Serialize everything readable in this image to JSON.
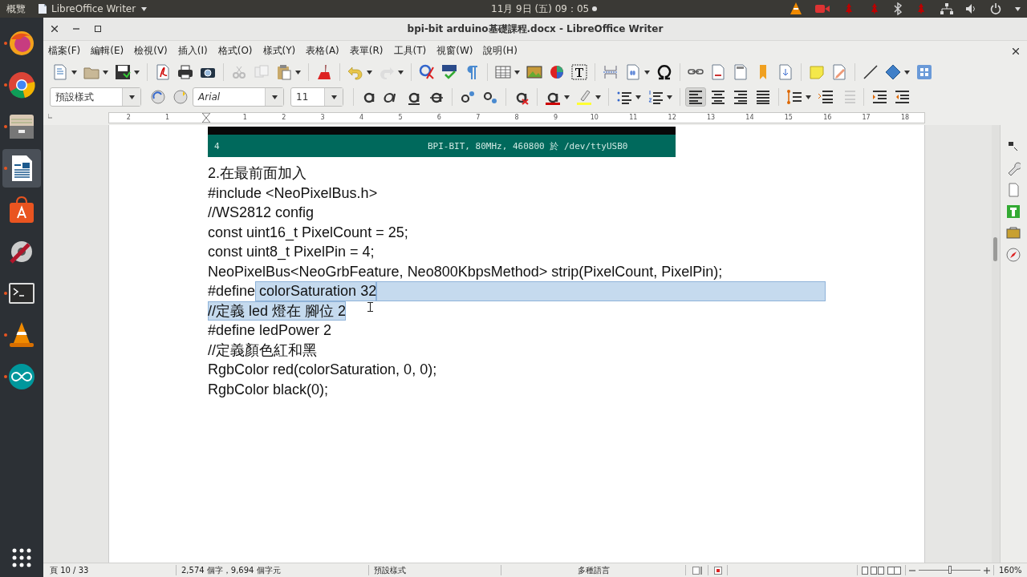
{
  "topbar": {
    "activities": "概覽",
    "app_menu": "LibreOffice Writer",
    "clock": "11月 9日 (五) 09：05"
  },
  "dock": [
    {
      "kind": "firefox",
      "running": true,
      "selected": false
    },
    {
      "kind": "chrome",
      "running": true,
      "selected": false
    },
    {
      "kind": "files",
      "running": true,
      "selected": false
    },
    {
      "kind": "writer",
      "running": true,
      "selected": true
    },
    {
      "kind": "store",
      "running": false,
      "selected": false
    },
    {
      "kind": "settings",
      "running": false,
      "selected": false
    },
    {
      "kind": "terminal",
      "running": true,
      "selected": false
    },
    {
      "kind": "vlc",
      "running": true,
      "selected": false
    },
    {
      "kind": "arduino",
      "running": true,
      "selected": false
    }
  ],
  "window": {
    "title": "bpi-bit arduino基礎課程.docx - LibreOffice Writer"
  },
  "menu": [
    "檔案(F)",
    "編輯(E)",
    "檢視(V)",
    "插入(I)",
    "格式(O)",
    "樣式(Y)",
    "表格(A)",
    "表單(R)",
    "工具(T)",
    "視窗(W)",
    "說明(H)"
  ],
  "formatting": {
    "paragraph_style": "預設樣式",
    "font": "Arial",
    "size": "11",
    "alignment": [
      {
        "selected": true
      },
      {
        "selected": false
      },
      {
        "selected": false
      },
      {
        "selected": false
      }
    ]
  },
  "ruler": {
    "left_labels": [
      "2",
      "1"
    ],
    "right_labels": [
      "1",
      "2",
      "3",
      "4",
      "5",
      "6",
      "7",
      "8",
      "9",
      "10",
      "11",
      "12",
      "13",
      "14",
      "15",
      "16",
      "17",
      "18"
    ]
  },
  "document": {
    "terminal_strip": {
      "line_number": "4",
      "status": "BPI-BIT, 80MHz, 460800 於 /dev/ttyUSB0"
    },
    "paragraphs": [
      {
        "runs": [
          {
            "text": "2.在最前面加入",
            "selected": false
          }
        ],
        "break_selected": false
      },
      {
        "runs": [
          {
            "text": "#include <NeoPixelBus.h>",
            "selected": false
          }
        ],
        "break_selected": false
      },
      {
        "runs": [
          {
            "text": "//WS2812 config",
            "selected": false
          }
        ],
        "break_selected": false
      },
      {
        "runs": [
          {
            "text": "const uint16_t PixelCount = 25;",
            "selected": false
          }
        ],
        "break_selected": false
      },
      {
        "runs": [
          {
            "text": "const uint8_t PixelPin = 4;",
            "selected": false
          }
        ],
        "break_selected": false
      },
      {
        "runs": [
          {
            "text": "NeoPixelBus<NeoGrbFeature, Neo800KbpsMethod> strip(PixelCount, PixelPin);",
            "selected": false
          }
        ],
        "break_selected": false
      },
      {
        "runs": [
          {
            "text": "#define",
            "selected": false
          },
          {
            "text": " colorSaturation 32",
            "selected": true
          }
        ],
        "break_selected": true
      },
      {
        "runs": [
          {
            "text": "//定義 led 燈在 腳位 2",
            "selected": true
          }
        ],
        "break_selected": false
      },
      {
        "runs": [
          {
            "text": "#define ledPower 2",
            "selected": false
          }
        ],
        "break_selected": false
      },
      {
        "runs": [
          {
            "text": "//定義顏色紅和黑",
            "selected": false
          }
        ],
        "break_selected": false
      },
      {
        "runs": [
          {
            "text": "RgbColor red(colorSaturation, 0, 0);",
            "selected": false
          }
        ],
        "break_selected": false
      },
      {
        "runs": [
          {
            "text": "RgbColor black(0);",
            "selected": false
          }
        ],
        "break_selected": false
      }
    ]
  },
  "status_bar": {
    "page": "頁 10 / 33",
    "counts": "2,574 個字，9,694 個字元",
    "style": "預設樣式",
    "language": "多種語言",
    "zoom": {
      "level": 0.5
    },
    "zoom_reading": "160%"
  }
}
